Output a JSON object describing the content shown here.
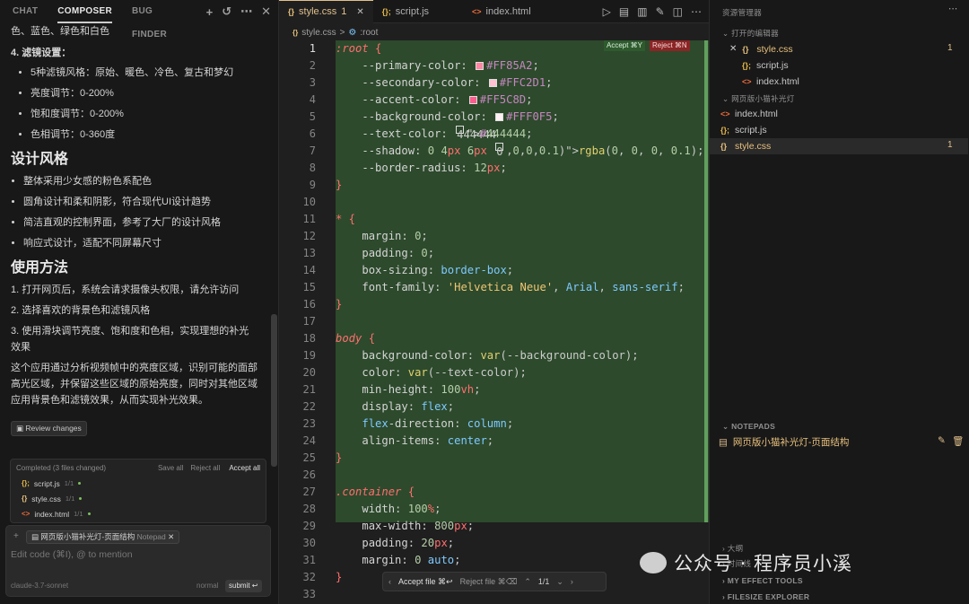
{
  "left": {
    "tabs": [
      "CHAT",
      "COMPOSER",
      "BUG FINDER"
    ],
    "chat": {
      "top_fragment": "色、蓝色、绿色和白色",
      "filter_heading": "4. 滤镜设置：",
      "filter_items": [
        "5种滤镜风格：原始、暖色、冷色、复古和梦幻",
        "亮度调节：0-200%",
        "饱和度调节：0-200%",
        "色相调节：0-360度"
      ],
      "design_heading": "设计风格",
      "design_items": [
        "整体采用少女感的粉色系配色",
        "圆角设计和柔和阴影，符合现代UI设计趋势",
        "简洁直观的控制界面，参考了大厂的设计风格",
        "响应式设计，适配不同屏幕尺寸"
      ],
      "usage_heading": "使用方法",
      "usage_items": [
        "1. 打开网页后，系统会请求摄像头权限，请允许访问",
        "2. 选择喜欢的背景色和滤镜风格",
        "3. 使用滑块调节亮度、饱和度和色相，实现理想的补光效果"
      ],
      "paragraph": "这个应用通过分析视频帧中的亮度区域，识别可能的面部高光区域，并保留这些区域的原始亮度，同时对其他区域应用背景色和滤镜效果，从而实现补光效果。",
      "review_button": "Review changes"
    },
    "composer_box": {
      "status": "Completed (3 files changed)",
      "save_all": "Save all",
      "reject_all": "Reject all",
      "accept_all": "Accept all",
      "files": [
        {
          "icon": "{};",
          "name": "script.js",
          "count": "1/1"
        },
        {
          "icon": "{}",
          "name": "style.css",
          "count": "1/1"
        },
        {
          "icon": "<>",
          "name": "index.html",
          "count": "1/1"
        }
      ]
    },
    "input": {
      "chip_label": "网页版小猫补光灯-页面结构",
      "chip_sub": "Notepad",
      "placeholder": "Edit code (⌘I), @ to mention",
      "model": "claude-3.7-sonnet",
      "mode": "normal",
      "submit": "submit ↩"
    }
  },
  "editor": {
    "tabs": [
      {
        "label": "style.css",
        "badge": "1",
        "icon": "{}"
      },
      {
        "label": "script.js",
        "badge": "",
        "icon": "{};"
      },
      {
        "label": "index.html",
        "badge": "",
        "icon": "<>"
      }
    ],
    "breadcrumb": [
      "style.css",
      ">",
      ":root"
    ],
    "accept_label": "Accept ⌘Y",
    "reject_label": "Reject ⌘N",
    "bottom": {
      "accept_file": "Accept file ⌘↩",
      "reject_file": "Reject file ⌘⌫",
      "pager": "1/1"
    },
    "lines": [
      ":root {",
      "    --primary-color: #FF85A2;",
      "    --secondary-color: #FFC2D1;",
      "    --accent-color: #FF5C8D;",
      "    --background-color: #FFF0F5;",
      "    --text-color: #444444;",
      "    --shadow: 0 4px 6px rgba(0, 0, 0, 0.1);",
      "    --border-radius: 12px;",
      "}",
      "",
      "* {",
      "    margin: 0;",
      "    padding: 0;",
      "    box-sizing: border-box;",
      "    font-family: 'Helvetica Neue', Arial, sans-serif;",
      "}",
      "",
      "body {",
      "    background-color: var(--background-color);",
      "    color: var(--text-color);",
      "    min-height: 100vh;",
      "    display: flex;",
      "    flex-direction: column;",
      "    align-items: center;",
      "}",
      "",
      ".container {",
      "    width: 100%;",
      "    max-width: 800px;",
      "    padding: 20px;",
      "    margin: 0 auto;",
      "}",
      ""
    ],
    "swatches": {
      "primary": "#FF85A2",
      "secondary": "#FFC2D1",
      "accent": "#FF5C8D",
      "background": "#FFF0F5",
      "text": "#444444"
    }
  },
  "right": {
    "title": "资源管理器",
    "open_editors": "打开的编辑器",
    "open_files": [
      {
        "icon": "{}",
        "name": "style.css",
        "badge": "1"
      },
      {
        "icon": "{};",
        "name": "script.js",
        "badge": ""
      },
      {
        "icon": "<>",
        "name": "index.html",
        "badge": ""
      }
    ],
    "project": "网页版小猫补光灯",
    "project_files": [
      {
        "icon": "<>",
        "name": "index.html",
        "badge": ""
      },
      {
        "icon": "{};",
        "name": "script.js",
        "badge": ""
      },
      {
        "icon": "{}",
        "name": "style.css",
        "badge": "1"
      }
    ],
    "notepads": "NOTEPADS",
    "notepad_item": "网页版小猫补光灯-页面结构",
    "outline": "大纲",
    "timeline": "时间线",
    "effect_tools": "MY EFFECT TOOLS",
    "filesize": "FILESIZE EXPLORER"
  },
  "watermark": "公众号 · 程序员小溪"
}
